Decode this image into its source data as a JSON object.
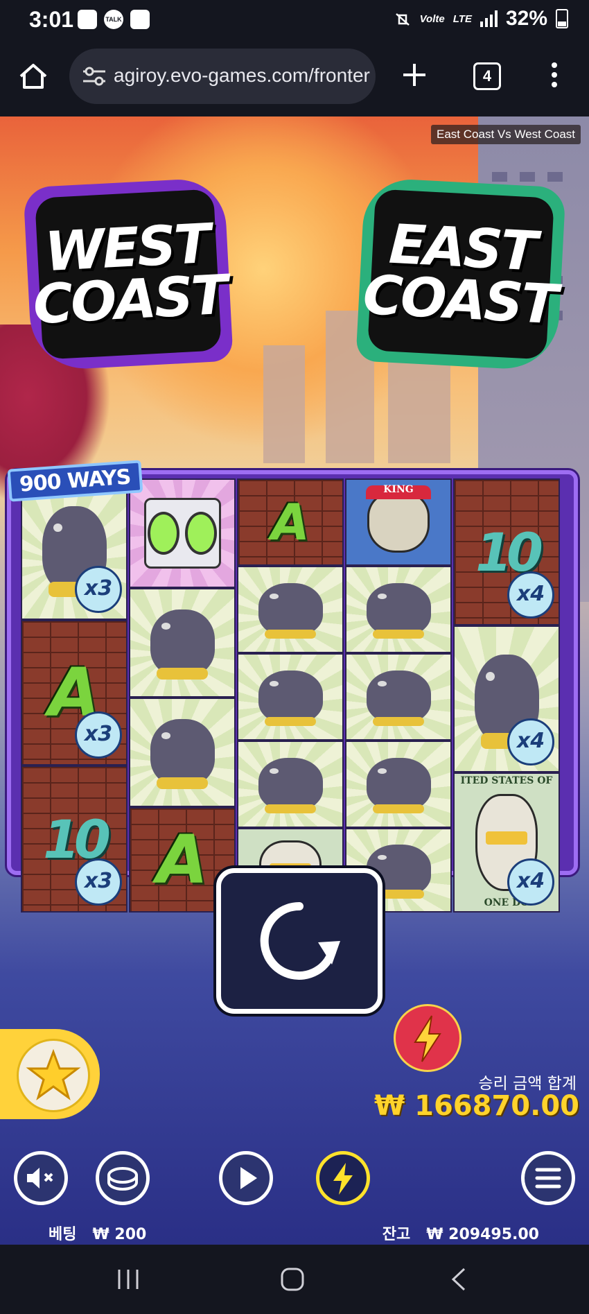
{
  "status_bar": {
    "time": "3:01",
    "network_small": "Volte",
    "network_type": "LTE",
    "battery": "32%",
    "talk_badge": "TALK"
  },
  "browser": {
    "url": "agiroy.evo-games.com/fronter",
    "tab_count": "4"
  },
  "game": {
    "title_tag": "East Coast Vs West Coast",
    "logo_west": [
      "WEST",
      "COAST"
    ],
    "logo_east": [
      "EAST",
      "COAST"
    ],
    "ways_badge": "900 WAYS",
    "reels": [
      [
        {
          "symbol": "bulldog",
          "multiplier": "x3"
        },
        {
          "symbol": "A",
          "multiplier": "x3"
        },
        {
          "symbol": "10",
          "multiplier": "x3"
        }
      ],
      [
        {
          "symbol": "boombox"
        },
        {
          "symbol": "bulldog"
        },
        {
          "symbol": "bulldog"
        },
        {
          "symbol": "A"
        }
      ],
      [
        {
          "symbol": "A"
        },
        {
          "symbol": "bulldog"
        },
        {
          "symbol": "bulldog"
        },
        {
          "symbol": "bulldog"
        },
        {
          "symbol": "washington"
        }
      ],
      [
        {
          "symbol": "lincoln",
          "cap_text": "KING"
        },
        {
          "symbol": "bulldog"
        },
        {
          "symbol": "bulldog"
        },
        {
          "symbol": "bulldog"
        },
        {
          "symbol": "bulldog"
        }
      ],
      [
        {
          "symbol": "10",
          "multiplier": "x4"
        },
        {
          "symbol": "bulldog",
          "multiplier": "x4"
        },
        {
          "symbol": "dollar-bill",
          "multiplier": "x4",
          "top_text": "ITED STATES OF",
          "bottom_text": "ONE DO"
        }
      ]
    ],
    "win_label": "승리 금액 합계",
    "win_amount": "₩ 166870.00",
    "bet_label": "베팅",
    "bet_value": "₩ 200",
    "balance_label": "잔고",
    "balance_value": "₩ 209495.00"
  },
  "colors": {
    "accent_yellow": "#ffd32b",
    "board_purple": "#5b2fb0",
    "turbo_red": "#e0334a"
  },
  "icons": [
    "home-icon",
    "tune-icon",
    "plus-icon",
    "tabs-icon",
    "more-icon",
    "mute-icon",
    "coin-icon",
    "play-icon",
    "turbo-icon",
    "menu-icon",
    "spin-icon",
    "favorite-star-icon"
  ]
}
